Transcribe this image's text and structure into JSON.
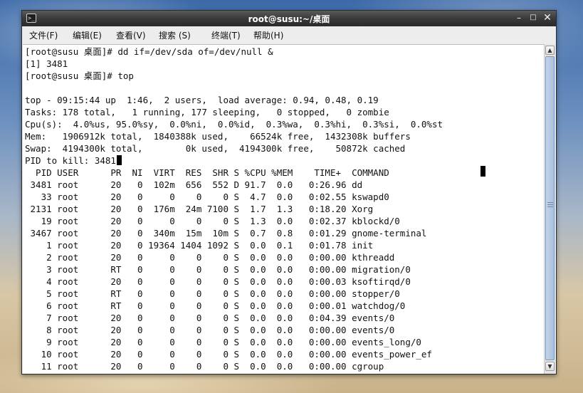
{
  "window": {
    "title": "root@susu:~/桌面",
    "terminal_icon": ">_",
    "minimize": "–",
    "maximize": "□",
    "close": "✕"
  },
  "menu": {
    "file": "文件(F)",
    "edit": "编辑(E)",
    "view": "查看(V)",
    "search": "搜索 (S)",
    "terminal": "终端(T)",
    "help": "帮助(H)"
  },
  "terminal": {
    "cmd1": "[root@susu 桌面]# dd if=/dev/sda of=/dev/null &",
    "job": "[1] 3481",
    "cmd2": "[root@susu 桌面]# top",
    "blank": "",
    "top_line": "top - 09:15:44 up  1:46,  2 users,  load average: 0.94, 0.48, 0.19",
    "tasks": "Tasks: 178 total,   1 running, 177 sleeping,   0 stopped,   0 zombie",
    "cpu": "Cpu(s):  4.0%us, 95.0%sy,  0.0%ni,  0.0%id,  0.3%wa,  0.3%hi,  0.3%si,  0.0%st",
    "mem": "Mem:   1906912k total,  1840388k used,    66524k free,  1432308k buffers",
    "swap": "Swap:  4194300k total,        0k used,  4194300k free,    50872k cached",
    "prompt": "PID to kill: 3481",
    "header": "  PID USER      PR  NI  VIRT  RES  SHR S %CPU %MEM    TIME+  COMMAND",
    "rows": [
      " 3481 root      20   0  102m  656  552 D 91.7  0.0   0:26.96 dd",
      "   33 root      20   0     0    0    0 S  4.7  0.0   0:02.55 kswapd0",
      " 2131 root      20   0  176m  24m 7100 S  1.7  1.3   0:18.20 Xorg",
      "   19 root      20   0     0    0    0 S  1.3  0.0   0:02.37 kblockd/0",
      " 3467 root      20   0  340m  15m  10m S  0.7  0.8   0:01.29 gnome-terminal",
      "    1 root      20   0 19364 1404 1092 S  0.0  0.1   0:01.78 init",
      "    2 root      20   0     0    0    0 S  0.0  0.0   0:00.00 kthreadd",
      "    3 root      RT   0     0    0    0 S  0.0  0.0   0:00.00 migration/0",
      "    4 root      20   0     0    0    0 S  0.0  0.0   0:00.03 ksoftirqd/0",
      "    5 root      RT   0     0    0    0 S  0.0  0.0   0:00.00 stopper/0",
      "    6 root      RT   0     0    0    0 S  0.0  0.0   0:00.01 watchdog/0",
      "    7 root      20   0     0    0    0 S  0.0  0.0   0:04.39 events/0",
      "    8 root      20   0     0    0    0 S  0.0  0.0   0:00.00 events/0",
      "    9 root      20   0     0    0    0 S  0.0  0.0   0:00.00 events_long/0",
      "   10 root      20   0     0    0    0 S  0.0  0.0   0:00.00 events_power_ef",
      "   11 root      20   0     0    0    0 S  0.0  0.0   0:00.00 cgroup"
    ]
  },
  "scrollbar": {
    "up": "▲",
    "down": "▼"
  }
}
